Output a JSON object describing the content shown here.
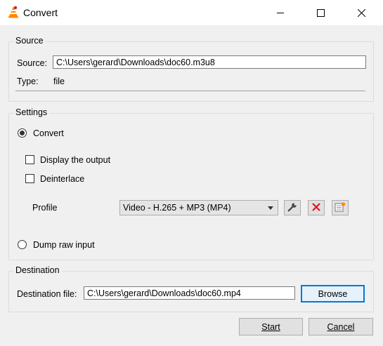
{
  "window": {
    "title": "Convert",
    "controls": [
      "minimize-icon",
      "maximize-icon",
      "close-icon"
    ]
  },
  "source": {
    "group_title": "Source",
    "source_label": "Source:",
    "source_value": "C:\\Users\\gerard\\Downloads\\doc60.m3u8",
    "type_label": "Type:",
    "type_value": "file"
  },
  "settings": {
    "group_title": "Settings",
    "convert_label": "Convert",
    "convert_selected": true,
    "display_output_label": "Display the output",
    "display_output_checked": false,
    "deinterlace_label": "Deinterlace",
    "deinterlace_checked": false,
    "profile_label": "Profile",
    "profile_value": "Video - H.265 + MP3 (MP4)",
    "profile_tools": [
      "wrench-icon",
      "delete-icon",
      "new-profile-icon"
    ],
    "dump_raw_label": "Dump raw input",
    "dump_raw_selected": false
  },
  "destination": {
    "group_title": "Destination",
    "file_label": "Destination file:",
    "file_value": "C:\\Users\\gerard\\Downloads\\doc60.mp4",
    "browse_label": "Browse"
  },
  "footer": {
    "start_label": "Start",
    "cancel_label": "Cancel"
  },
  "colors": {
    "accent": "#0078d7",
    "delete_red": "#e81123",
    "vlc_orange": "#ff8800"
  }
}
